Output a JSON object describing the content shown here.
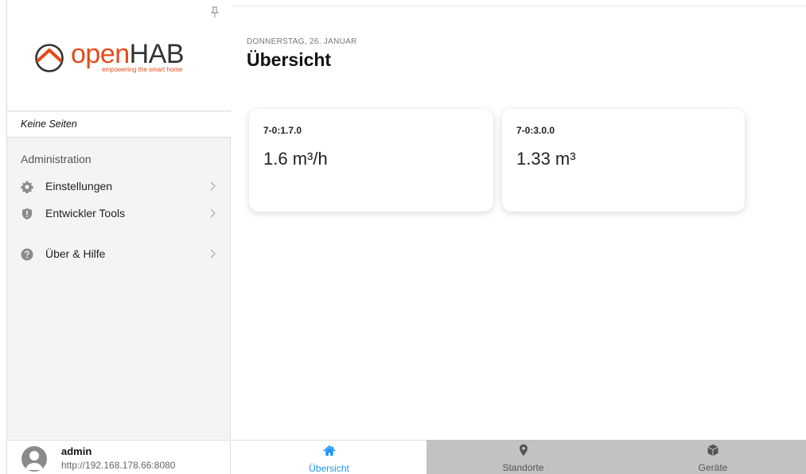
{
  "sidebar": {
    "logo": {
      "brand_part1": "open",
      "brand_part2": "HAB",
      "tagline": "empowering the smart home"
    },
    "no_pages": "Keine Seiten",
    "section_title": "Administration",
    "items": [
      {
        "label": "Einstellungen",
        "icon": "gear-icon"
      },
      {
        "label": "Entwickler Tools",
        "icon": "shield-icon"
      },
      {
        "label": "Über & Hilfe",
        "icon": "question-icon"
      }
    ]
  },
  "user": {
    "name": "admin",
    "url": "http://192.168.178.66:8080"
  },
  "main": {
    "date": "Donnerstag, 26. Januar",
    "title": "Übersicht",
    "cards": [
      {
        "label": "7-0:1.7.0",
        "value": "1.6 m³/h"
      },
      {
        "label": "7-0:3.0.0",
        "value": "1.33 m³"
      }
    ]
  },
  "tabs": [
    {
      "label": "Übersicht",
      "icon": "home-icon",
      "active": true
    },
    {
      "label": "Standorte",
      "icon": "location-pin-icon",
      "active": false
    },
    {
      "label": "Geräte",
      "icon": "cube-icon",
      "active": false
    }
  ],
  "colors": {
    "accent": "#2196f3",
    "brand": "#e64a19",
    "tab_inactive_bg": "#c2c2c2"
  }
}
